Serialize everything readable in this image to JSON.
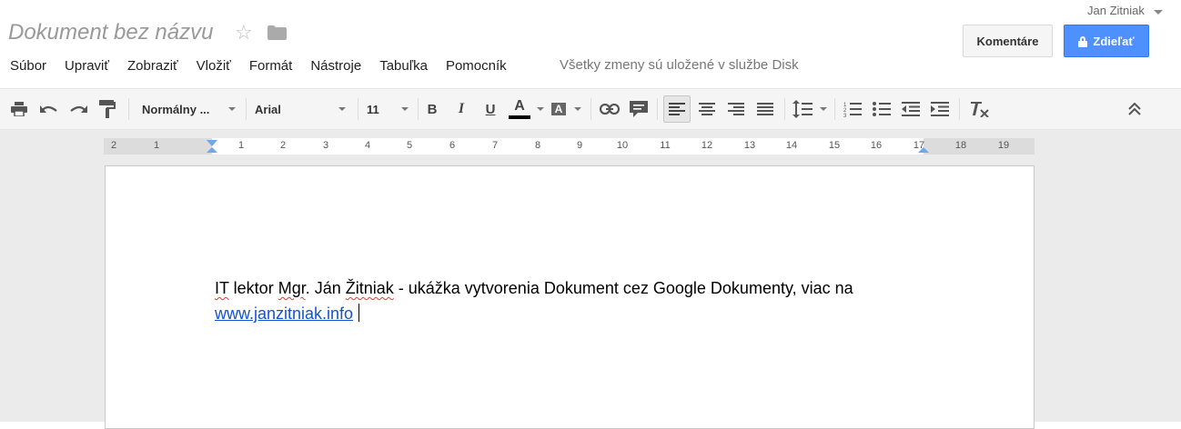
{
  "document": {
    "title": "Dokument bez názvu"
  },
  "user": {
    "name": "Jan Zitniak"
  },
  "buttons": {
    "comments": "Komentáre",
    "share": "Zdieľať"
  },
  "menu": {
    "items": [
      "Súbor",
      "Upraviť",
      "Zobraziť",
      "Vložiť",
      "Formát",
      "Nástroje",
      "Tabuľka",
      "Pomocník"
    ],
    "save_status": "Všetky zmeny sú uložené v službe Disk"
  },
  "toolbar": {
    "style": "Normálny ...",
    "font": "Arial",
    "size": "11"
  },
  "ruler": {
    "numbers": [
      "2",
      "1",
      "1",
      "1",
      "2",
      "3",
      "4",
      "5",
      "6",
      "7",
      "8",
      "9",
      "10",
      "11",
      "12",
      "13",
      "14",
      "15",
      "16",
      "17",
      "18",
      "19"
    ]
  },
  "content": {
    "line1_part1": "IT",
    "line1_part2": " lektor ",
    "line1_part3": "Mgr",
    "line1_part4": ". Ján ",
    "line1_part5": "Žitniak",
    "line1_part6": " - ukážka vytvorenia Dokument cez Google Dokumenty, viac na",
    "link": "www.janzitniak.info"
  },
  "colors": {
    "accent": "#4d90fe",
    "link": "#1155cc",
    "text_color_bar": "#000000"
  }
}
